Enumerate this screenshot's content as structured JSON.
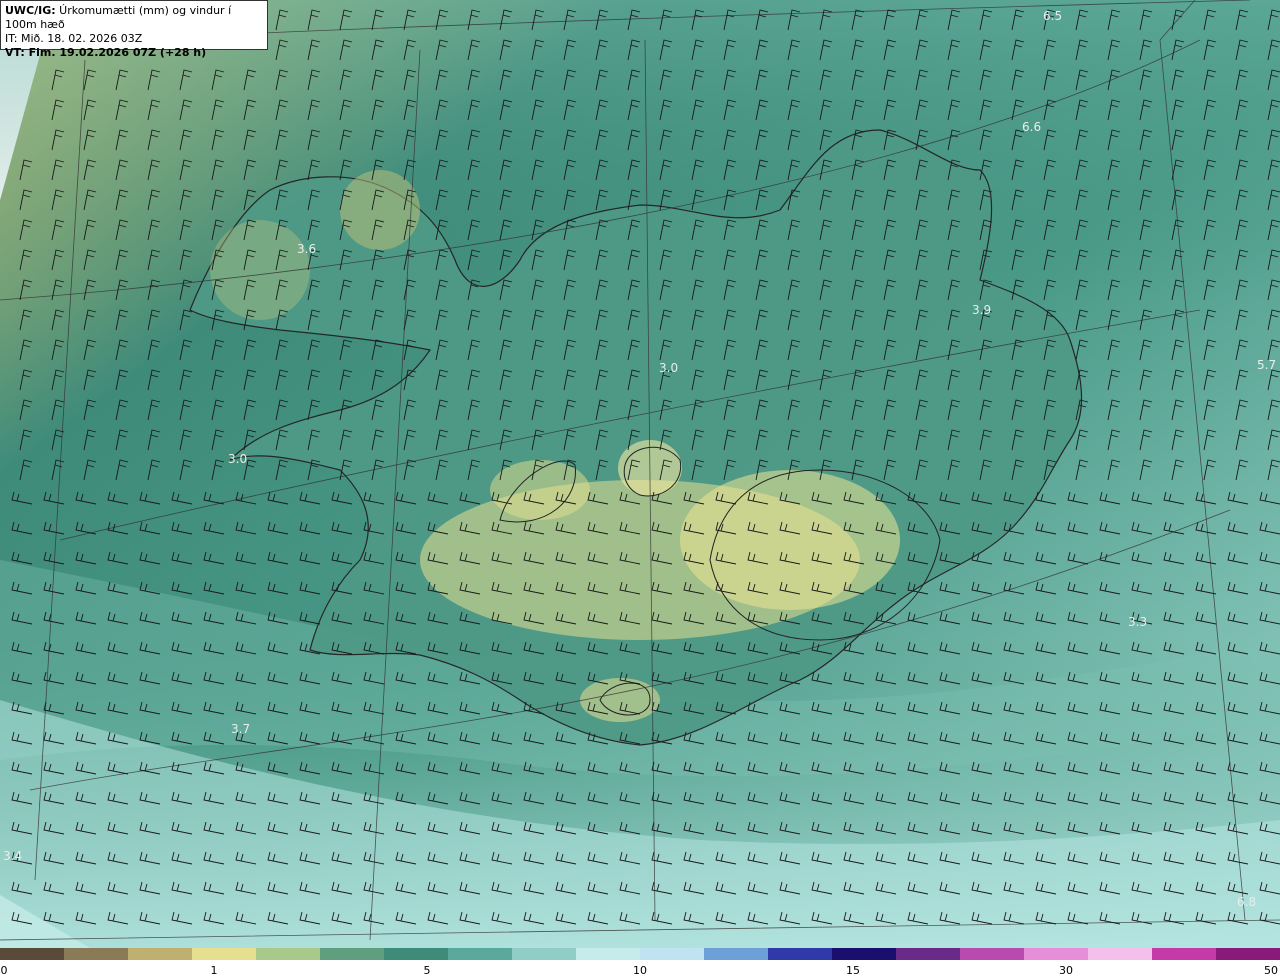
{
  "header": {
    "title_bold": "UWC/IG:",
    "title_rest": " Úrkomumætti (mm) og vindur í 100m hæð",
    "init_time": "IT: Mið. 18. 02. 2026 03Z",
    "valid_time": "VT: Fim. 19.02.2026 07Z (+28 h)"
  },
  "map_labels": [
    "6.5",
    "6.6",
    "3.6",
    "3.9",
    "5.7",
    "3.0",
    "3.0",
    "3.3",
    "3.7",
    "3.4",
    "6.8"
  ],
  "colorbar": {
    "ticks": [
      "0",
      "1",
      "5",
      "10",
      "15",
      "30",
      "50"
    ],
    "colors": [
      "#5a4a3a",
      "#8a7a56",
      "#bfb070",
      "#e6df8e",
      "#a8c98a",
      "#5f9e7e",
      "#3f8b7a",
      "#5aa99c",
      "#8fcdc6",
      "#c5ecea",
      "#bfe3f0",
      "#6ea0d8",
      "#2f3aa8",
      "#1a0f6e",
      "#6a2a8a",
      "#b84ab0",
      "#e68ed8",
      "#f3c0ec",
      "#c43aa8",
      "#8a1a7a"
    ]
  }
}
